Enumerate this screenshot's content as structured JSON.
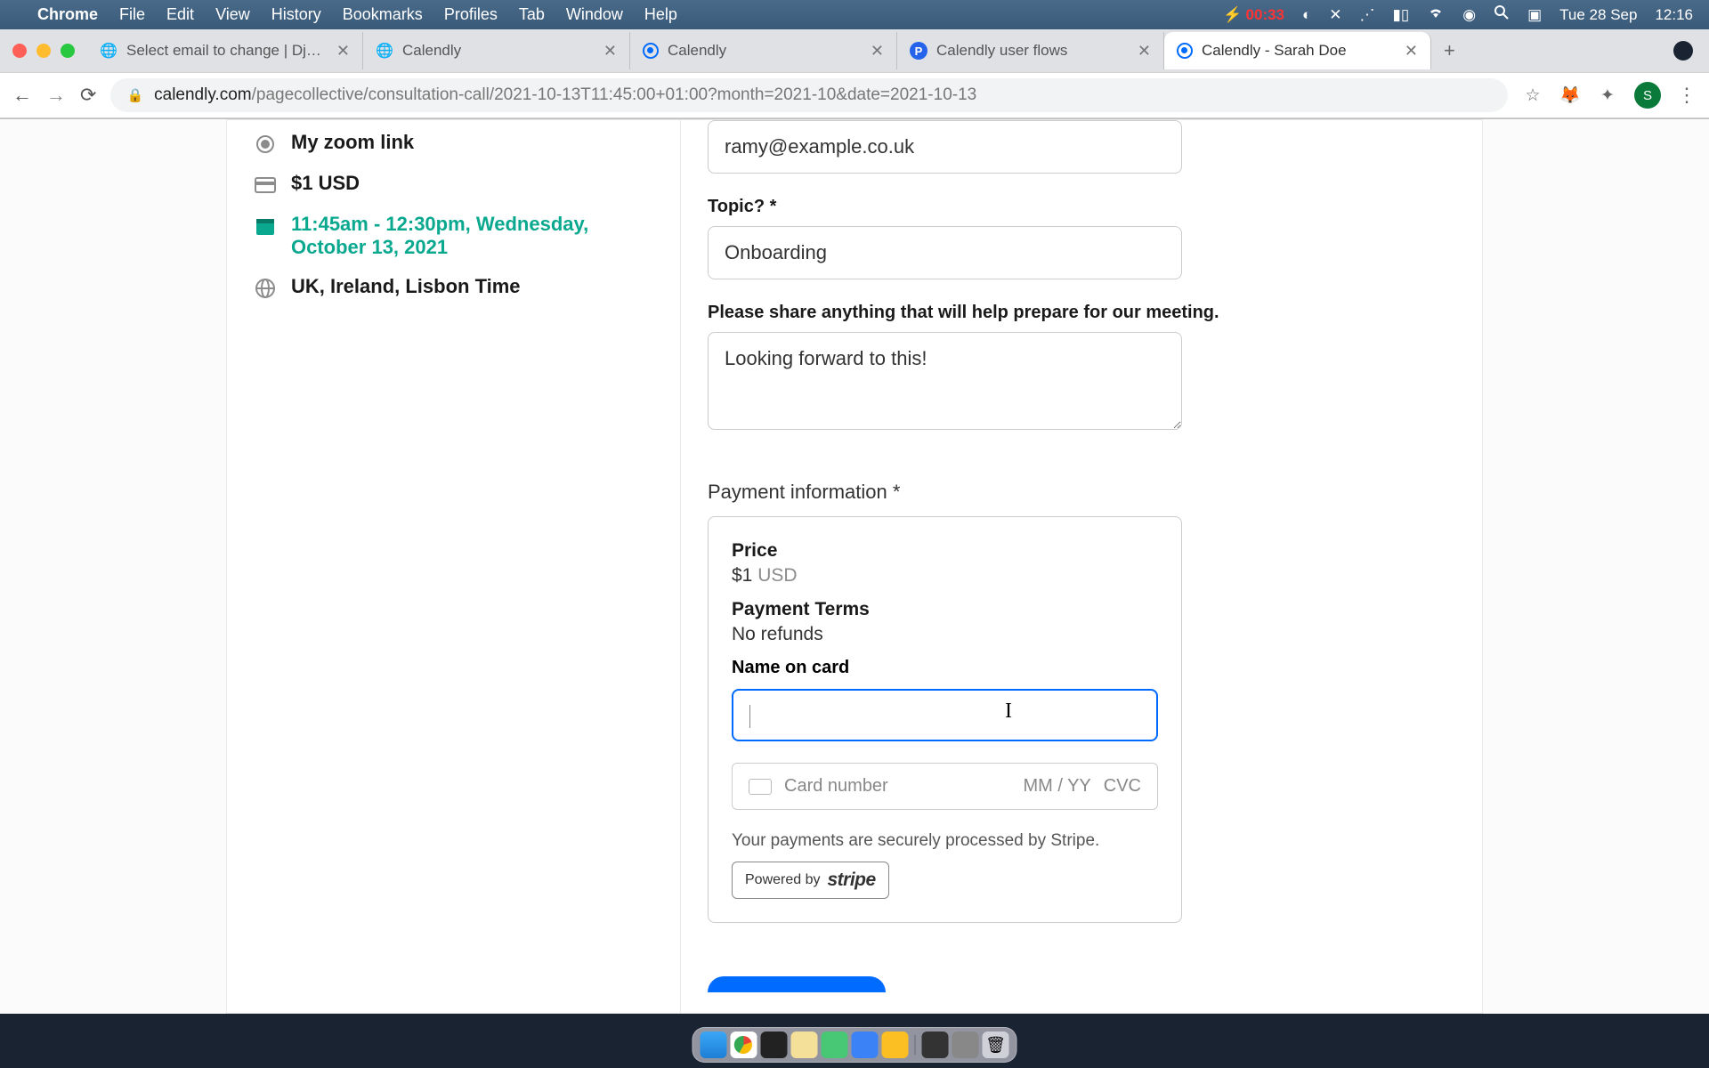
{
  "menubar": {
    "app_name": "Chrome",
    "items": [
      "File",
      "Edit",
      "View",
      "History",
      "Bookmarks",
      "Profiles",
      "Tab",
      "Window",
      "Help"
    ],
    "battery_time": "00:33",
    "date": "Tue 28 Sep",
    "clock": "12:16"
  },
  "tabs": [
    {
      "title": "Select email to change | Django",
      "icon": "globe"
    },
    {
      "title": "Calendly",
      "icon": "globe"
    },
    {
      "title": "Calendly",
      "icon": "calendly"
    },
    {
      "title": "Calendly user flows",
      "icon": "p"
    },
    {
      "title": "Calendly - Sarah Doe",
      "icon": "calendly",
      "active": true
    }
  ],
  "url": {
    "domain": "calendly.com",
    "path": "/pagecollective/consultation-call/2021-10-13T11:45:00+01:00?month=2021-10&date=2021-10-13"
  },
  "avatar_letter": "S",
  "sidebar": {
    "location": "My zoom link",
    "price": "$1 USD",
    "datetime": "11:45am - 12:30pm, Wednesday, October 13, 2021",
    "timezone": "UK, Ireland, Lisbon Time"
  },
  "form": {
    "email_value": "ramy@example.co.uk",
    "topic_label": "Topic? *",
    "topic_value": "Onboarding",
    "notes_label": "Please share anything that will help prepare for our meeting.",
    "notes_value": "Looking forward to this!",
    "payment_label": "Payment information *",
    "price_label": "Price",
    "price_amount": "$1",
    "price_currency": "USD",
    "terms_label": "Payment Terms",
    "terms_value": "No refunds",
    "name_on_card_label": "Name on card",
    "name_on_card_value": "",
    "card_placeholder": "Card number",
    "card_exp": "MM / YY",
    "card_cvc": "CVC",
    "secure_text": "Your payments are securely processed by Stripe.",
    "powered_by": "Powered by",
    "stripe": "stripe"
  }
}
